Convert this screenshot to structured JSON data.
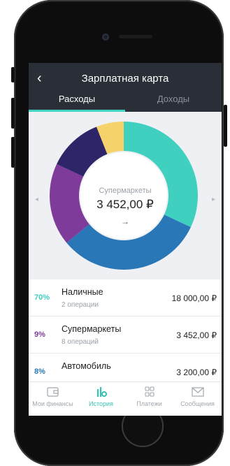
{
  "header": {
    "title": "Зарплатная карта",
    "back_icon": "chevron-left-icon"
  },
  "tabs": [
    {
      "label": "Расходы",
      "active": true
    },
    {
      "label": "Доходы",
      "active": false
    }
  ],
  "donut": {
    "center_category": "Супермаркеты",
    "center_amount": "3 452,00 ₽",
    "center_arrow": "→",
    "segments": [
      {
        "color": "#3fd0c0",
        "fraction": 0.32
      },
      {
        "color": "#2a77b8",
        "fraction": 0.32
      },
      {
        "color": "#7e3b9a",
        "fraction": 0.18
      },
      {
        "color": "#2e2468",
        "fraction": 0.12
      },
      {
        "color": "#f5d36a",
        "fraction": 0.06
      }
    ]
  },
  "list": [
    {
      "percent": "70%",
      "percent_color": "#3fd0c0",
      "name": "Наличные",
      "ops": "2 операции",
      "amount": "18 000,00 ₽"
    },
    {
      "percent": "9%",
      "percent_color": "#7e3b9a",
      "name": "Супермаркеты",
      "ops": "8 операций",
      "amount": "3 452,00 ₽"
    },
    {
      "percent": "8%",
      "percent_color": "#2a77b8",
      "name": "Автомобиль",
      "ops": "",
      "amount": "3 200,00 ₽"
    }
  ],
  "tabbar": [
    {
      "label": "Мои финансы",
      "icon": "wallet-icon",
      "active": false
    },
    {
      "label": "История",
      "icon": "history-bars-icon",
      "active": true
    },
    {
      "label": "Платежи",
      "icon": "grid-icon",
      "active": false
    },
    {
      "label": "Сообщения",
      "icon": "envelope-icon",
      "active": false
    }
  ]
}
